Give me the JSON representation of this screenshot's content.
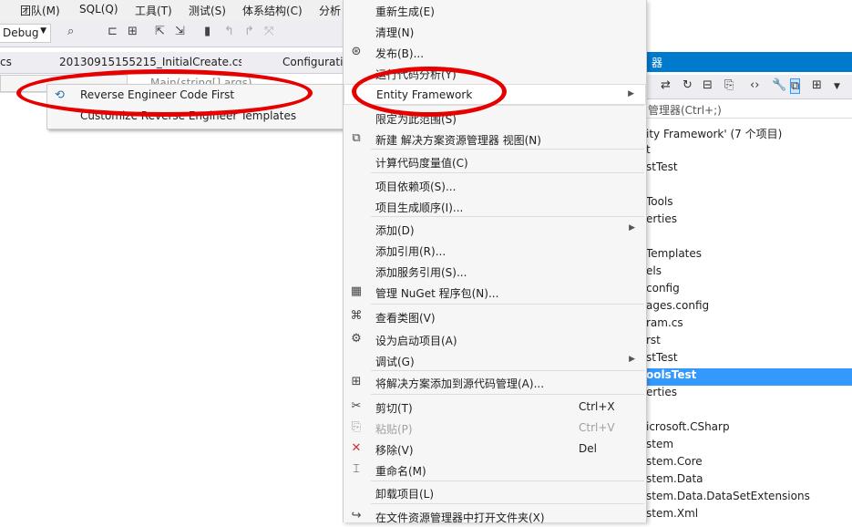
{
  "menubar": {
    "items": [
      "团队(M)",
      "SQL(Q)",
      "工具(T)",
      "测试(S)",
      "体系结构(C)",
      "分析"
    ]
  },
  "toolbar": {
    "config": "Debug"
  },
  "tabs": [
    "cs",
    "20130915155215_InitialCreate.cs",
    "Configurati"
  ],
  "nav": {
    "method": "Main(string[] args)"
  },
  "submenu": {
    "items": [
      "Reverse Engineer Code First",
      "Customize Reverse Engineer Templates"
    ]
  },
  "context_menu": {
    "items": [
      {
        "label": "重新生成(E)"
      },
      {
        "label": "清理(N)"
      },
      {
        "label": "发布(B)...",
        "icon": "publish-icon"
      },
      {
        "label": "运行代码分析(Y)"
      },
      {
        "label": "Entity Framework",
        "arrow": true
      },
      {
        "label": "限定为此范围(S)"
      },
      {
        "label": "新建 解决方案资源管理器 视图(N)",
        "icon": "new-view-icon"
      },
      {
        "label": "计算代码度量值(C)"
      },
      {
        "label": "项目依赖项(S)..."
      },
      {
        "label": "项目生成顺序(I)..."
      },
      {
        "label": "添加(D)",
        "arrow": true
      },
      {
        "label": "添加引用(R)..."
      },
      {
        "label": "添加服务引用(S)..."
      },
      {
        "label": "管理 NuGet 程序包(N)...",
        "icon": "nuget-icon"
      },
      {
        "label": "查看类图(V)",
        "icon": "class-diagram-icon"
      },
      {
        "label": "设为启动项目(A)",
        "icon": "gear-icon"
      },
      {
        "label": "调试(G)",
        "arrow": true
      },
      {
        "label": "将解决方案添加到源代码管理(A)...",
        "icon": "source-control-icon"
      },
      {
        "label": "剪切(T)",
        "shortcut": "Ctrl+X",
        "icon": "cut-icon"
      },
      {
        "label": "粘贴(P)",
        "shortcut": "Ctrl+V",
        "icon": "paste-icon",
        "disabled": true
      },
      {
        "label": "移除(V)",
        "shortcut": "Del",
        "icon": "remove-icon"
      },
      {
        "label": "重命名(M)",
        "icon": "rename-icon"
      },
      {
        "label": "卸载项目(L)"
      },
      {
        "label": "在文件资源管理器中打开文件夹(X)",
        "icon": "open-folder-icon"
      }
    ]
  },
  "solution_explorer": {
    "title": "器",
    "search": "管理器(Ctrl+;)",
    "items": [
      "ity Framework' (7 个项目)",
      "t",
      "stTest",
      "",
      "Tools",
      "erties",
      "",
      "Templates",
      "els",
      "config",
      "ages.config",
      "ram.cs",
      "rst",
      "stTest",
      "oolsTest",
      "erties",
      "",
      "icrosoft.CSharp",
      "stem",
      "stem.Core",
      "stem.Data",
      "stem.Data.DataSetExtensions",
      "stem.Xml"
    ]
  },
  "colors": {
    "accent": "#007acc",
    "selection": "#3399ff",
    "annotation": "#e60000"
  }
}
